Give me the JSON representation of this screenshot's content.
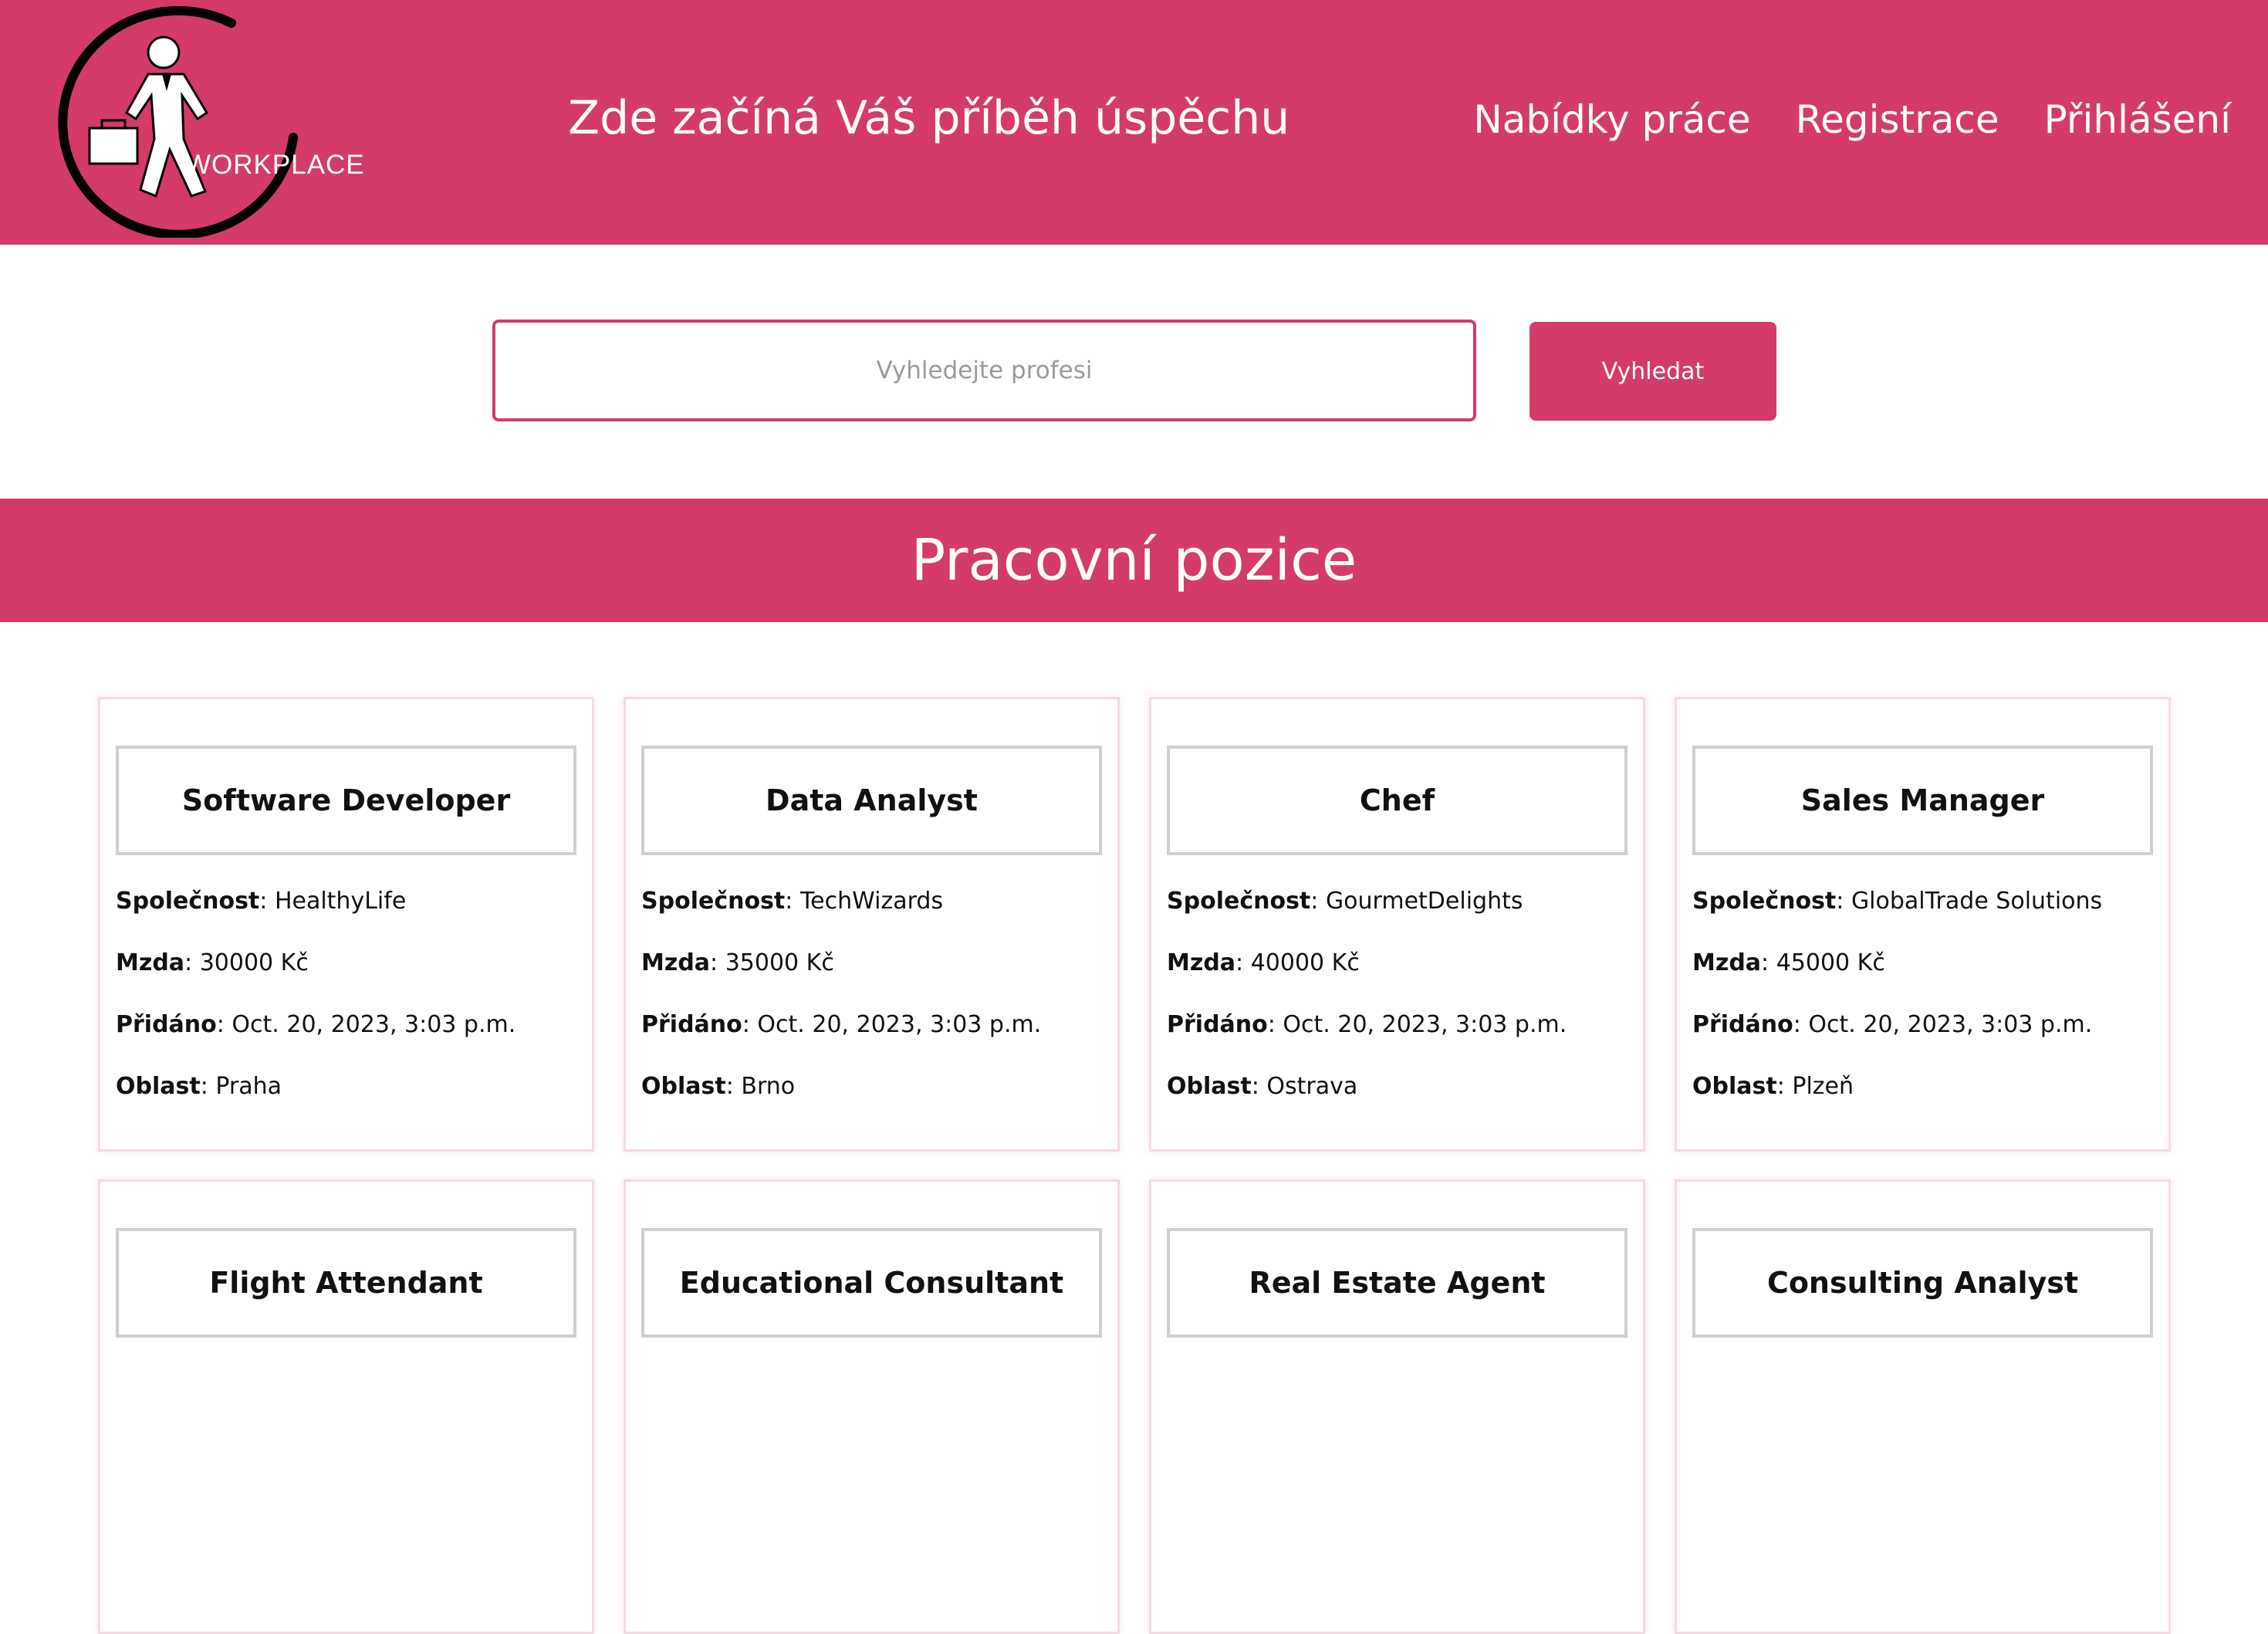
{
  "header": {
    "logo_text": "WORKPLACE",
    "tagline": "Zde začíná Váš příběh úspěchu",
    "nav": [
      "Nabídky práce",
      "Registrace",
      "Přihlášení"
    ],
    "brand_color": "#d43b68"
  },
  "search": {
    "placeholder": "Vyhledejte profesi",
    "value": "",
    "button_label": "Vyhledat"
  },
  "section": {
    "title": "Pracovní pozice"
  },
  "labels": {
    "company": "Společnost",
    "salary": "Mzda",
    "added": "Přidáno",
    "region": "Oblast"
  },
  "jobs": [
    {
      "title": "Software Developer",
      "company": "HealthyLife",
      "salary": "30000 Kč",
      "added": "Oct. 20, 2023, 3:03 p.m.",
      "region": "Praha"
    },
    {
      "title": "Data Analyst",
      "company": "TechWizards",
      "salary": "35000 Kč",
      "added": "Oct. 20, 2023, 3:03 p.m.",
      "region": "Brno"
    },
    {
      "title": "Chef",
      "company": "GourmetDelights",
      "salary": "40000 Kč",
      "added": "Oct. 20, 2023, 3:03 p.m.",
      "region": "Ostrava"
    },
    {
      "title": "Sales Manager",
      "company": "GlobalTrade Solutions",
      "salary": "45000 Kč",
      "added": "Oct. 20, 2023, 3:03 p.m.",
      "region": "Plzeň"
    },
    {
      "title": "Flight Attendant"
    },
    {
      "title": "Educational Consultant"
    },
    {
      "title": "Real Estate Agent"
    },
    {
      "title": "Consulting Analyst"
    }
  ]
}
